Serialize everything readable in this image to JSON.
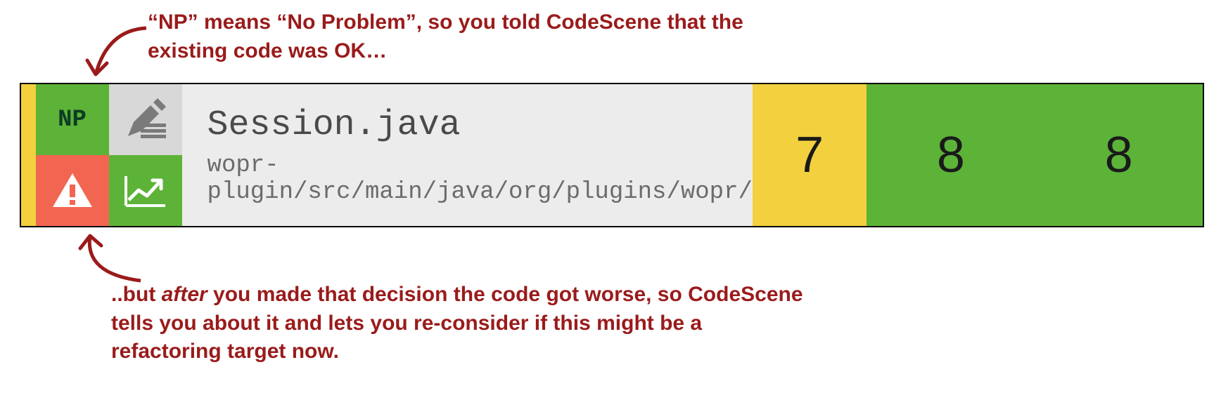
{
  "annotations": {
    "top": "“NP” means “No Problem”, so you told CodeScene that the existing code was OK…",
    "bottom_prefix": "..but ",
    "bottom_em": "after",
    "bottom_suffix": " you made that decision the code got worse, so CodeScene tells you about it and lets you re-consider if this might be a refactoring target now."
  },
  "row": {
    "np_label": "NP",
    "file_name": "Session.java",
    "file_path": "wopr-plugin/src/main/java/org/plugins/wopr/",
    "score_yellow": "7",
    "score_green_a": "8",
    "score_green_b": "8"
  },
  "icons": {
    "edit": "edit-pencil",
    "warn": "warning-triangle",
    "trend": "trend-up"
  },
  "colors": {
    "annotation": "#9a1b1b",
    "green": "#5cb338",
    "yellow": "#f3d03e",
    "red": "#f26651",
    "grey": "#d8d8d8",
    "file_bg": "#ececec"
  }
}
